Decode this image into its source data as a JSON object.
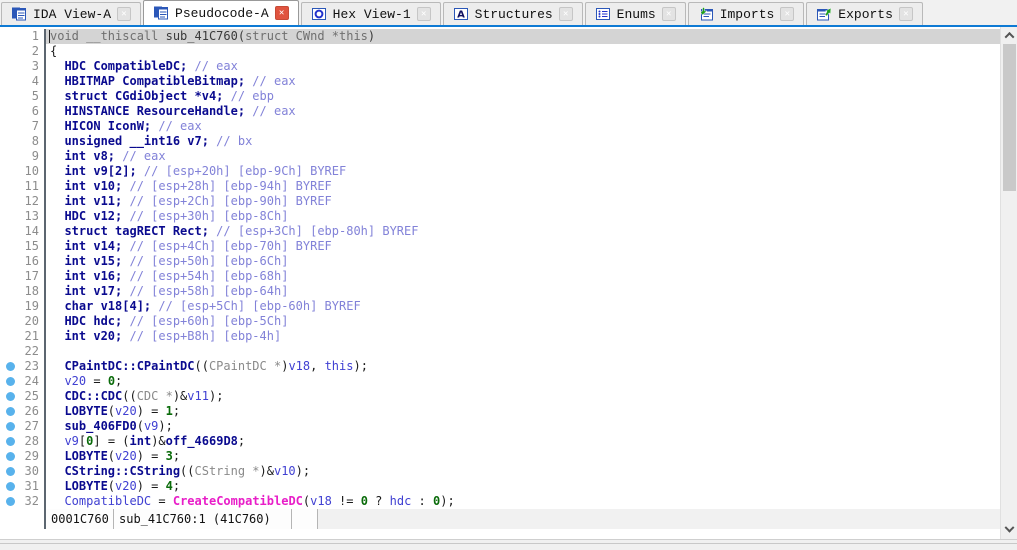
{
  "colors": {
    "accent": "#0e7ad4",
    "keyword_navy": "#0a0a8f",
    "local_var_blue": "#4040d2",
    "comment_periwinkle": "#8282d8",
    "number_green": "#0a6b0a",
    "import_magenta": "#e81ec8",
    "cast_gray": "#8a8a8a",
    "current_line_highlight": "#d4d4d4",
    "breakpoint_dot": "#58b2ec"
  },
  "tabbar": {
    "tabs": [
      {
        "label": "IDA View-A",
        "icon": "ida-view-icon",
        "active": false,
        "closable": true
      },
      {
        "label": "Pseudocode-A",
        "icon": "pseudocode-icon",
        "active": true,
        "closable": true
      },
      {
        "label": "Hex View-1",
        "icon": "hex-view-icon",
        "active": false,
        "closable": true
      },
      {
        "label": "Structures",
        "icon": "structures-icon",
        "active": false,
        "closable": true
      },
      {
        "label": "Enums",
        "icon": "enums-icon",
        "active": false,
        "closable": true
      },
      {
        "label": "Imports",
        "icon": "imports-icon",
        "active": false,
        "closable": true
      },
      {
        "label": "Exports",
        "icon": "exports-icon",
        "active": false,
        "closable": true
      }
    ]
  },
  "code": {
    "lines": [
      {
        "n": 1,
        "hl": true,
        "dot": false,
        "segs": [
          [
            "hk",
            "void __thiscall "
          ],
          [
            "hn",
            "sub_41C760("
          ],
          [
            "hk",
            "struct CWnd *this"
          ],
          [
            "hn",
            ")"
          ]
        ]
      },
      {
        "n": 2,
        "dot": false,
        "segs": [
          [
            "p",
            "{"
          ]
        ]
      },
      {
        "n": 3,
        "dot": false,
        "segs": [
          [
            "k",
            "  HDC CompatibleDC;"
          ],
          [
            "c",
            " // eax"
          ]
        ]
      },
      {
        "n": 4,
        "dot": false,
        "segs": [
          [
            "k",
            "  HBITMAP CompatibleBitmap;"
          ],
          [
            "c",
            " // eax"
          ]
        ]
      },
      {
        "n": 5,
        "dot": false,
        "segs": [
          [
            "k",
            "  struct CGdiObject *v4;"
          ],
          [
            "c",
            " // ebp"
          ]
        ]
      },
      {
        "n": 6,
        "dot": false,
        "segs": [
          [
            "k",
            "  HINSTANCE ResourceHandle;"
          ],
          [
            "c",
            " // eax"
          ]
        ]
      },
      {
        "n": 7,
        "dot": false,
        "segs": [
          [
            "k",
            "  HICON IconW;"
          ],
          [
            "c",
            " // eax"
          ]
        ]
      },
      {
        "n": 8,
        "dot": false,
        "segs": [
          [
            "k",
            "  unsigned __int16 v7;"
          ],
          [
            "c",
            " // bx"
          ]
        ]
      },
      {
        "n": 9,
        "dot": false,
        "segs": [
          [
            "k",
            "  int v8;"
          ],
          [
            "c",
            " // eax"
          ]
        ]
      },
      {
        "n": 10,
        "dot": false,
        "segs": [
          [
            "k",
            "  int v9[2];"
          ],
          [
            "c",
            " // [esp+20h] [ebp-9Ch] BYREF"
          ]
        ]
      },
      {
        "n": 11,
        "dot": false,
        "segs": [
          [
            "k",
            "  int v10;"
          ],
          [
            "c",
            " // [esp+28h] [ebp-94h] BYREF"
          ]
        ]
      },
      {
        "n": 12,
        "dot": false,
        "segs": [
          [
            "k",
            "  int v11;"
          ],
          [
            "c",
            " // [esp+2Ch] [ebp-90h] BYREF"
          ]
        ]
      },
      {
        "n": 13,
        "dot": false,
        "segs": [
          [
            "k",
            "  HDC v12;"
          ],
          [
            "c",
            " // [esp+30h] [ebp-8Ch]"
          ]
        ]
      },
      {
        "n": 14,
        "dot": false,
        "segs": [
          [
            "k",
            "  struct tagRECT Rect;"
          ],
          [
            "c",
            " // [esp+3Ch] [ebp-80h] BYREF"
          ]
        ]
      },
      {
        "n": 15,
        "dot": false,
        "segs": [
          [
            "k",
            "  int v14;"
          ],
          [
            "c",
            " // [esp+4Ch] [ebp-70h] BYREF"
          ]
        ]
      },
      {
        "n": 16,
        "dot": false,
        "segs": [
          [
            "k",
            "  int v15;"
          ],
          [
            "c",
            " // [esp+50h] [ebp-6Ch]"
          ]
        ]
      },
      {
        "n": 17,
        "dot": false,
        "segs": [
          [
            "k",
            "  int v16;"
          ],
          [
            "c",
            " // [esp+54h] [ebp-68h]"
          ]
        ]
      },
      {
        "n": 18,
        "dot": false,
        "segs": [
          [
            "k",
            "  int v17;"
          ],
          [
            "c",
            " // [esp+58h] [ebp-64h]"
          ]
        ]
      },
      {
        "n": 19,
        "dot": false,
        "segs": [
          [
            "k",
            "  char v18[4];"
          ],
          [
            "c",
            " // [esp+5Ch] [ebp-60h] BYREF"
          ]
        ]
      },
      {
        "n": 20,
        "dot": false,
        "segs": [
          [
            "k",
            "  HDC hdc;"
          ],
          [
            "c",
            " // [esp+60h] [ebp-5Ch]"
          ]
        ]
      },
      {
        "n": 21,
        "dot": false,
        "segs": [
          [
            "k",
            "  int v20;"
          ],
          [
            "c",
            " // [esp+B8h] [ebp-4h]"
          ]
        ]
      },
      {
        "n": 22,
        "dot": false,
        "segs": []
      },
      {
        "n": 23,
        "dot": true,
        "segs": [
          [
            "k",
            "  CPaintDC::CPaintDC"
          ],
          [
            "p",
            "(("
          ],
          [
            "g",
            "CPaintDC *"
          ],
          [
            "p",
            ")"
          ],
          [
            "v",
            "v18"
          ],
          [
            "p",
            ", "
          ],
          [
            "v",
            "this"
          ],
          [
            "p",
            ");"
          ]
        ]
      },
      {
        "n": 24,
        "dot": true,
        "segs": [
          [
            "v",
            "  v20"
          ],
          [
            "p",
            " = "
          ],
          [
            "n",
            "0"
          ],
          [
            "p",
            ";"
          ]
        ]
      },
      {
        "n": 25,
        "dot": true,
        "segs": [
          [
            "k",
            "  CDC::CDC"
          ],
          [
            "p",
            "(("
          ],
          [
            "g",
            "CDC *"
          ],
          [
            "p",
            ")&"
          ],
          [
            "v",
            "v11"
          ],
          [
            "p",
            ");"
          ]
        ]
      },
      {
        "n": 26,
        "dot": true,
        "segs": [
          [
            "k",
            "  LOBYTE"
          ],
          [
            "p",
            "("
          ],
          [
            "v",
            "v20"
          ],
          [
            "p",
            ") = "
          ],
          [
            "n",
            "1"
          ],
          [
            "p",
            ";"
          ]
        ]
      },
      {
        "n": 27,
        "dot": true,
        "segs": [
          [
            "k",
            "  sub_406FD0"
          ],
          [
            "p",
            "("
          ],
          [
            "v",
            "v9"
          ],
          [
            "p",
            ");"
          ]
        ]
      },
      {
        "n": 28,
        "dot": true,
        "segs": [
          [
            "v",
            "  v9"
          ],
          [
            "p",
            "["
          ],
          [
            "n",
            "0"
          ],
          [
            "p",
            "] = ("
          ],
          [
            "k",
            "int"
          ],
          [
            "p",
            ")&"
          ],
          [
            "k",
            "off_4669D8"
          ],
          [
            "p",
            ";"
          ]
        ]
      },
      {
        "n": 29,
        "dot": true,
        "segs": [
          [
            "k",
            "  LOBYTE"
          ],
          [
            "p",
            "("
          ],
          [
            "v",
            "v20"
          ],
          [
            "p",
            ") = "
          ],
          [
            "n",
            "3"
          ],
          [
            "p",
            ";"
          ]
        ]
      },
      {
        "n": 30,
        "dot": true,
        "segs": [
          [
            "k",
            "  CString::CString"
          ],
          [
            "p",
            "(("
          ],
          [
            "g",
            "CString *"
          ],
          [
            "p",
            ")&"
          ],
          [
            "v",
            "v10"
          ],
          [
            "p",
            ");"
          ]
        ]
      },
      {
        "n": 31,
        "dot": true,
        "segs": [
          [
            "k",
            "  LOBYTE"
          ],
          [
            "p",
            "("
          ],
          [
            "v",
            "v20"
          ],
          [
            "p",
            ") = "
          ],
          [
            "n",
            "4"
          ],
          [
            "p",
            ";"
          ]
        ]
      },
      {
        "n": 32,
        "dot": true,
        "segs": [
          [
            "v",
            "  CompatibleDC"
          ],
          [
            "p",
            " = "
          ],
          [
            "m",
            "CreateCompatibleDC"
          ],
          [
            "p",
            "("
          ],
          [
            "v",
            "v18"
          ],
          [
            "p",
            " != "
          ],
          [
            "n",
            "0"
          ],
          [
            "p",
            " ? "
          ],
          [
            "v",
            "hdc"
          ],
          [
            "p",
            " : "
          ],
          [
            "n",
            "0"
          ],
          [
            "p",
            ");"
          ]
        ]
      }
    ]
  },
  "status": {
    "address": "0001C760",
    "location": "sub_41C760:1 (41C760)"
  }
}
